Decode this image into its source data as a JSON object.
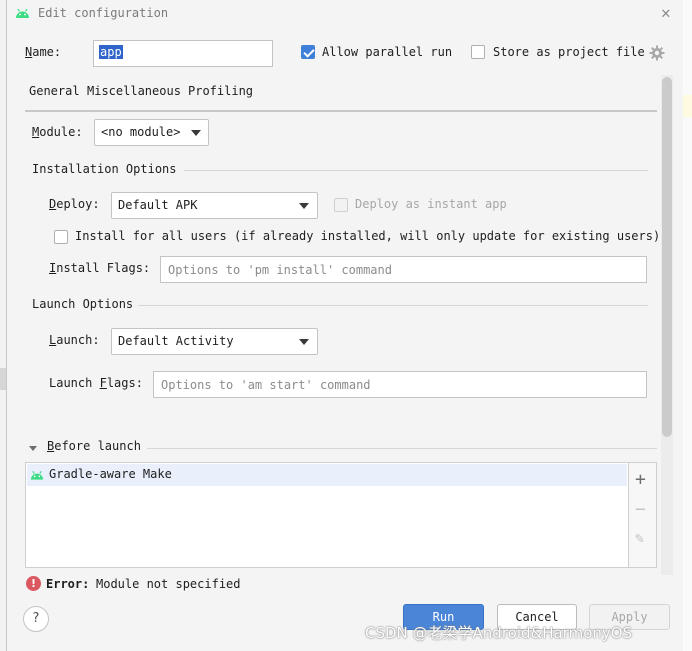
{
  "window": {
    "title": "Edit configuration",
    "close_glyph": "✕"
  },
  "header": {
    "name_label": "Name:",
    "name_value": "app",
    "allow_parallel_label": "Allow parallel run",
    "allow_parallel_checked": true,
    "store_label": "Store as project file",
    "store_checked": false
  },
  "tabs": [
    {
      "label": "General"
    },
    {
      "label": "Miscellaneous"
    },
    {
      "label": "Profiling"
    }
  ],
  "general": {
    "module_label": "Module:",
    "module_value": "<no module>",
    "installation_heading": "Installation Options",
    "deploy_label": "Deploy:",
    "deploy_value": "Default APK",
    "instant_app_label": "Deploy as instant app",
    "install_all_users_label": "Install for all users (if already installed, will only update for existing users)",
    "install_flags_label": "Install Flags:",
    "install_flags_placeholder": "Options to 'pm install' command",
    "launch_heading": "Launch Options",
    "launch_label": "Launch:",
    "launch_value": "Default Activity",
    "launch_flags_label": "Launch Flags:",
    "launch_flags_placeholder": "Options to 'am start' command"
  },
  "before_launch": {
    "heading": "Before launch",
    "items": [
      {
        "label": "Gradle-aware Make",
        "icon": "android-icon"
      }
    ],
    "add_glyph": "+",
    "remove_glyph": "−",
    "edit_glyph": "✎"
  },
  "error": {
    "prefix": "Error:",
    "message": "Module not specified"
  },
  "buttons": {
    "help": "?",
    "run": "Run",
    "cancel": "Cancel",
    "apply": "Apply"
  },
  "watermark": "CSDN @老梁学Android&HarmonyOS",
  "colors": {
    "accent": "#4a85d8",
    "error": "#db5860",
    "android_green": "#3ddc84"
  }
}
